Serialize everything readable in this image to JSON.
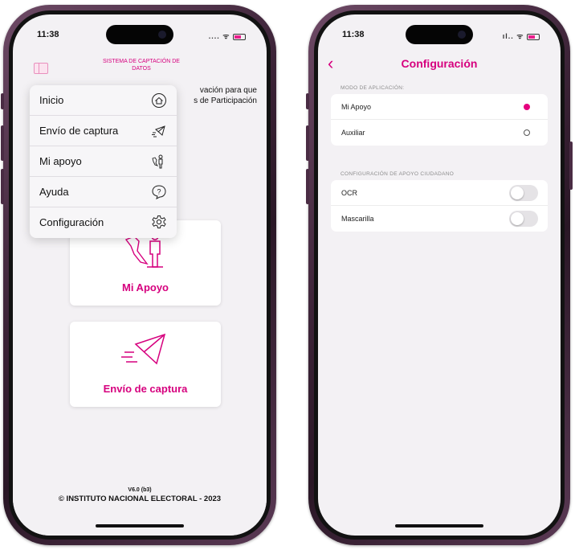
{
  "status": {
    "time": "11:38",
    "signal": "....",
    "right_signal": "ıl..",
    "wifi": "ᯤ"
  },
  "left_screen": {
    "app_title": "SISTEMA DE CAPTACIÓN DE DATOS",
    "welcome_text_line1": "vación para que",
    "welcome_text_line2": "s de Participación",
    "menu": [
      {
        "label": "Inicio",
        "icon": "home-icon"
      },
      {
        "label": "Envío de captura",
        "icon": "send-envelope-icon"
      },
      {
        "label": "Mi apoyo",
        "icon": "support-person-icon"
      },
      {
        "label": "Ayuda",
        "icon": "help-icon"
      },
      {
        "label": "Configuración",
        "icon": "gear-icon"
      }
    ],
    "cards": [
      {
        "label": "Mi Apoyo",
        "icon": "support-person-map-icon"
      },
      {
        "label": "Envío de captura",
        "icon": "send-envelope-icon"
      }
    ],
    "footer": {
      "version": "V6.0 (b3)",
      "copyright": "© INSTITUTO NACIONAL ELECTORAL - 2023"
    }
  },
  "right_screen": {
    "back_label": "‹",
    "title": "Configuración",
    "sections": [
      {
        "header": "MODO DE APLICACIÓN:",
        "rows": [
          {
            "label": "Mi Apoyo",
            "selected": true
          },
          {
            "label": "Auxiliar",
            "selected": false
          }
        ]
      },
      {
        "header": "CONFIGURACIÓN DE APOYO CIUDADANO",
        "rows": [
          {
            "label": "OCR",
            "toggle": false
          },
          {
            "label": "Mascarilla",
            "toggle": false
          }
        ]
      }
    ]
  },
  "colors": {
    "accent": "#d6007e",
    "frame": "#3c2337",
    "background": "#f3f1f4"
  }
}
